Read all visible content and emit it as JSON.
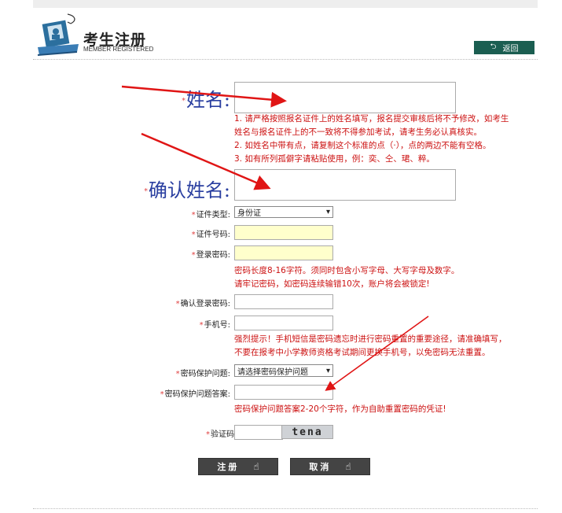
{
  "header": {
    "title": "考生注册",
    "subtitle": "MEMBER REGISTERED",
    "back_label": "返回"
  },
  "form": {
    "required_mark": "*",
    "name_label": "姓名:",
    "name_hints": [
      "1. 请严格按照报名证件上的姓名填写，报名提交审核后将不予修改，如考生",
      "姓名与报名证件上的不一致将不得参加考试，请考生务必认真核实。",
      "2. 如姓名中带有点，请复制这个标准的点（·），点的两边不能有空格。",
      "3. 如有所列孤僻字请粘贴使用，例：奕、仝、珺、粹。"
    ],
    "confirm_name_label": "确认姓名:",
    "id_type_label": "证件类型:",
    "id_type_value": "身份证",
    "id_number_label": "证件号码:",
    "password_label": "登录密码:",
    "password_hints": [
      "密码长度8-16字符。须同时包含小写字母、大写字母及数字。",
      "请牢记密码，如密码连续输错10次，账户将会被锁定!"
    ],
    "confirm_password_label": "确认登录密码:",
    "phone_label": "手机号:",
    "phone_hints": [
      "强烈提示！手机短信是密码遗忘时进行密码重置的重要途径，请准确填写，",
      "不要在报考中小学教师资格考试期间更换手机号，以免密码无法重置。"
    ],
    "security_question_label": "密码保护问题:",
    "security_question_value": "请选择密码保护问题",
    "security_answer_label": "密码保护问题答案:",
    "security_answer_hint": "密码保护问题答案2-20个字符，作为自助重置密码的凭证!",
    "captcha_label": "验证码",
    "captcha_text": "tena"
  },
  "buttons": {
    "submit_label": "注册",
    "cancel_label": "取消"
  },
  "colors": {
    "accent": "#1b5e51",
    "hint": "#cc1111",
    "big_label": "#2a3fa0",
    "arrow": "#e01515",
    "highlight_field": "#ffffcc"
  }
}
